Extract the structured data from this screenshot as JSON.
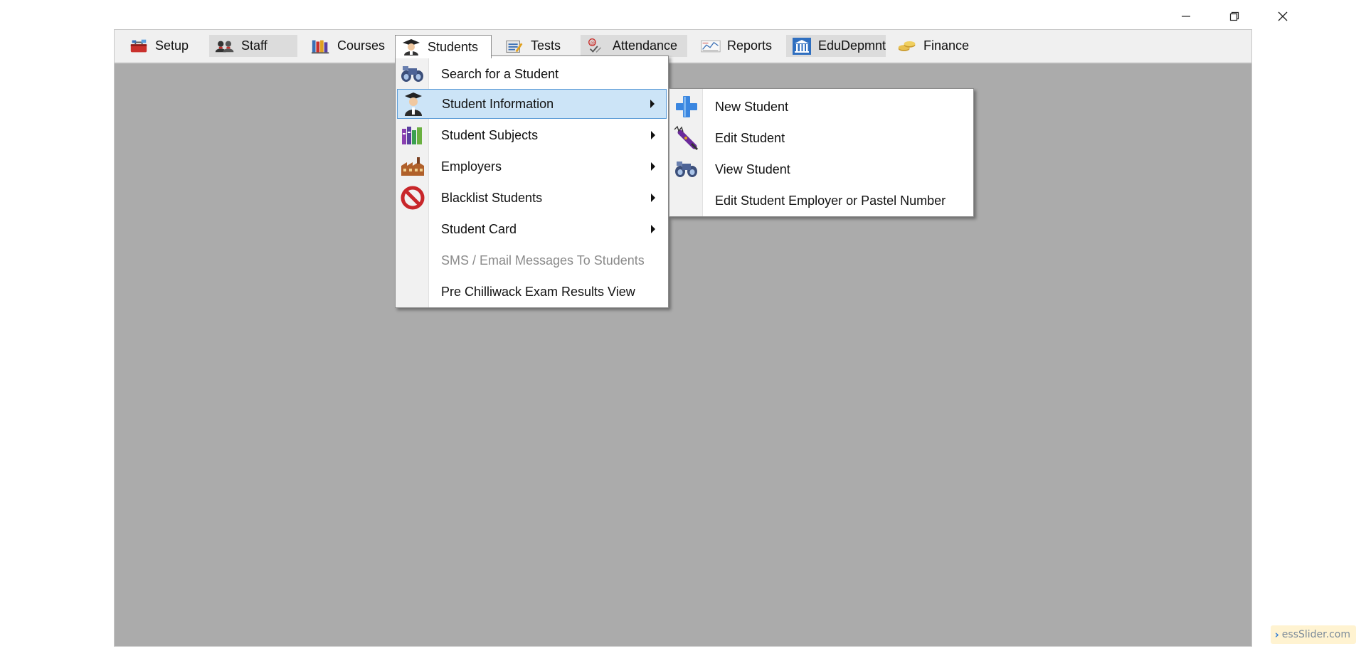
{
  "window_controls": [
    {
      "name": "minimize",
      "icon": "minimize-icon"
    },
    {
      "name": "restore",
      "icon": "restore-icon"
    },
    {
      "name": "close",
      "icon": "close-icon"
    }
  ],
  "menubar": {
    "items": [
      {
        "label": "Setup",
        "icon": "toolbox-icon"
      },
      {
        "label": "Staff",
        "icon": "people-icon"
      },
      {
        "label": "Courses",
        "icon": "books-icon"
      },
      {
        "label": "Students",
        "icon": "student-icon",
        "state": "open"
      },
      {
        "label": "Tests",
        "icon": "checklist-icon"
      },
      {
        "label": "Attendance",
        "icon": "attendance-icon"
      },
      {
        "label": "Reports",
        "icon": "report-chart-icon"
      },
      {
        "label": "EduDepmnt",
        "icon": "building-icon"
      },
      {
        "label": "Finance",
        "icon": "coins-icon"
      }
    ]
  },
  "students_menu": {
    "items": [
      {
        "label": "Search for a Student",
        "icon": "binoculars-icon",
        "submenu": false
      },
      {
        "label": "Student Information",
        "icon": "student-icon",
        "submenu": true,
        "highlighted": true
      },
      {
        "label": "Student Subjects",
        "icon": "books-icon",
        "submenu": true
      },
      {
        "label": "Employers",
        "icon": "factory-icon",
        "submenu": true
      },
      {
        "label": "Blacklist Students",
        "icon": "prohibited-icon",
        "submenu": true
      },
      {
        "label": "Student Card",
        "icon": "",
        "submenu": true
      },
      {
        "label": "SMS / Email Messages To Students",
        "icon": "",
        "submenu": false,
        "disabled": true
      },
      {
        "label": "Pre Chilliwack Exam Results View",
        "icon": "",
        "submenu": false
      }
    ]
  },
  "student_info_submenu": {
    "items": [
      {
        "label": "New Student",
        "icon": "plus-icon"
      },
      {
        "label": "Edit Student",
        "icon": "pen-edit-icon"
      },
      {
        "label": "View Student",
        "icon": "binoculars-icon"
      },
      {
        "label": "Edit Student Employer or Pastel Number",
        "icon": ""
      }
    ]
  },
  "watermark": {
    "text": "essSlider.com"
  },
  "colors": {
    "workspace": "#ababab",
    "menubar": "#f0f0f0",
    "highlight_fill": "#cce4f7",
    "highlight_border": "#5a9ad6",
    "disabled_text": "#8a8a8a"
  }
}
